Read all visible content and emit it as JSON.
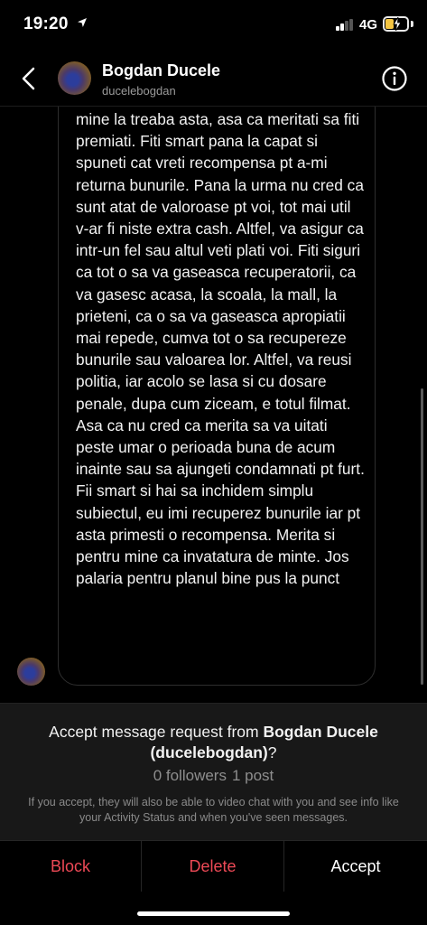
{
  "status_bar": {
    "time": "19:20",
    "network": "4G"
  },
  "header": {
    "name": "Bogdan Ducele",
    "username": "ducelebogdan",
    "back_icon": "chevron-left-icon",
    "info_icon": "info-circle-icon"
  },
  "message": {
    "paragraphs": [
      "mine la treaba asta, asa ca meritati sa fiti premiati. Fiti smart pana la capat si spuneti cat vreti recompensa pt a-mi returna bunurile. Pana la urma nu cred ca sunt atat de valoroase pt voi, tot mai util v-ar fi niste extra cash. Altfel, va asigur ca intr-un fel sau altul veti plati voi. Fiti siguri ca tot o sa va gaseasca recuperatorii, ca va gasesc acasa, la scoala, la mall, la prieteni, ca o sa va gaseasca apropiatii mai repede, cumva tot o sa recupereze bunurile sau valoarea lor. Altfel, va reusi politia, iar acolo se lasa si cu dosare penale, dupa cum ziceam, e totul filmat. Asa ca nu cred ca merita sa va uitati peste umar o perioada buna de acum inainte sau sa ajungeti condamnati pt furt.",
      "Fii smart si hai sa inchidem simplu subiectul, eu imi recuperez bunurile iar pt asta primesti o recompensa. Merita si pentru mine ca invatatura de minte. Jos palaria pentru planul bine pus la punct"
    ]
  },
  "request": {
    "title_prefix": "Accept message request from ",
    "title_name": "Bogdan Ducele",
    "title_username": "(ducelebogdan)",
    "title_suffix": "?",
    "followers": "0 followers",
    "posts": "1 post",
    "note": "If you accept, they will also be able to video chat with you and see info like your Activity Status and when you've seen messages."
  },
  "actions": {
    "block": "Block",
    "delete": "Delete",
    "accept": "Accept"
  },
  "colors": {
    "destructive": "#ed4956",
    "background": "#000000",
    "panel": "#181818",
    "battery": "#f4c542"
  }
}
